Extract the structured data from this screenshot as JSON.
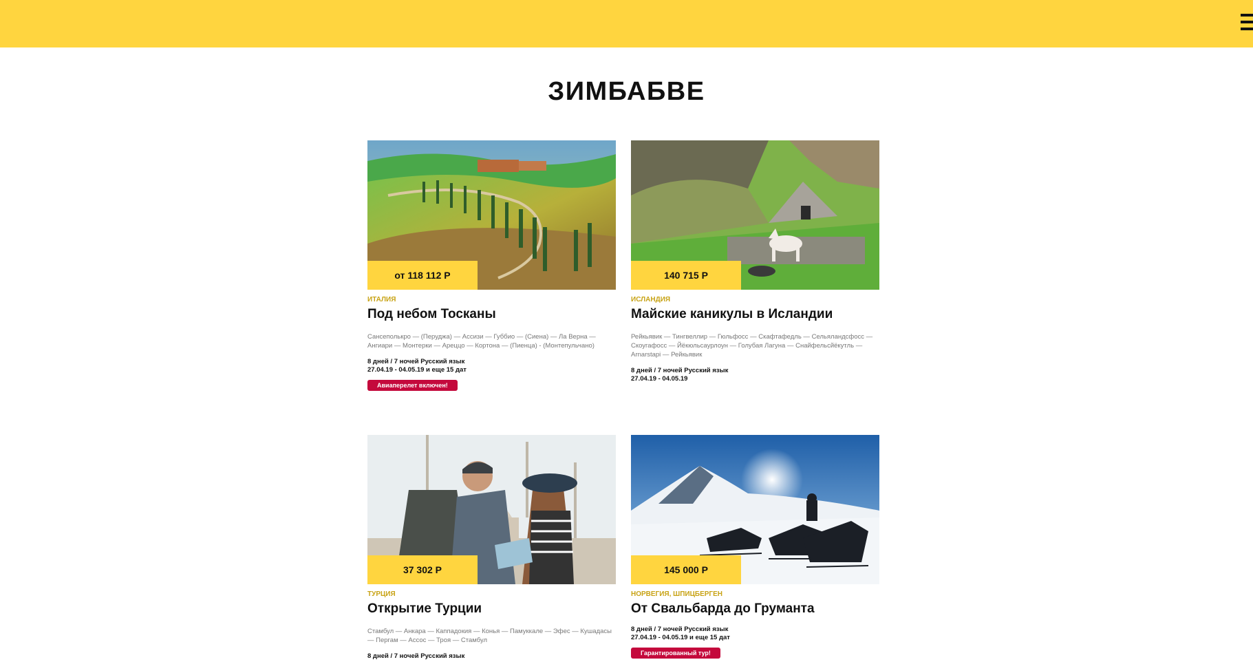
{
  "page": {
    "title": "ЗИМБАБВЕ"
  },
  "header": {
    "menu_icon": "hamburger-menu-icon",
    "accent_color": "#ffd53f"
  },
  "tours": [
    {
      "price": "от 118 112 Р",
      "country": "ИТАЛИЯ",
      "title": "Под небом Тосканы",
      "route": "Сансеполькро — (Перуджа) — Ассизи — Губбио — (Сиена) — Ла Верна — Ангиари — Монтерки — Ареццо — Кортона — (Пиенца) - (Монтепульчано)",
      "meta_line1": "8 дней / 7 ночей Русский язык",
      "meta_line2": "27.04.19 - 04.05.19 и еще 15 дат",
      "badge": "Авиаперелет включен!"
    },
    {
      "price": "140 715 Р",
      "country": "ИСЛАНДИЯ",
      "title": "Майские каникулы в Исландии",
      "route": "Рейкьявик — Тингвеллир — Гюльфосс — Скафтафедль — Сельяландсфосс — Скоугафосс — Йёкюльсаурлоун — Голубая Лагуна — Снайфельсйёкутль — Arnarstapi — Рейкьявик",
      "meta_line1": "8 дней / 7 ночей Русский язык",
      "meta_line2": "27.04.19 - 04.05.19",
      "badge": ""
    },
    {
      "price": "37 302 Р",
      "country": "ТУРЦИЯ",
      "title": "Открытие Турции",
      "route": "Стамбул — Анкара — Каппадокия — Конья — Памуккале — Эфес — Кушадасы — Пергам — Ассос — Троя — Стамбул",
      "meta_line1": "8 дней / 7 ночей Русский язык",
      "meta_line2": "",
      "badge": ""
    },
    {
      "price": "145 000 Р",
      "country": "НОРВЕГИЯ, ШПИЦБЕРГЕН",
      "title": "От Свальбарда до Груманта",
      "route": "",
      "meta_line1": "8 дней / 7 ночей Русский язык",
      "meta_line2": "27.04.19 - 04.05.19 и еще 15 дат",
      "badge": "Гарантированный тур!"
    }
  ]
}
